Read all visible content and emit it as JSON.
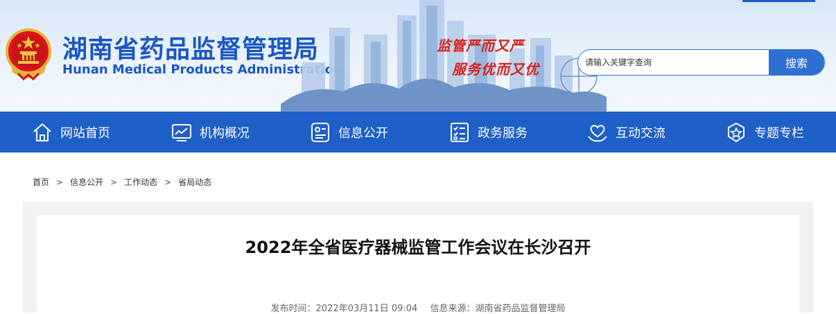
{
  "header": {
    "title": "湖南省药品监督管理局",
    "subtitle": "Hunan Medical Products Administration",
    "slogan_line1": "监管严而又严",
    "slogan_line2": "服务优而又优"
  },
  "search": {
    "placeholder": "请输入关键字查询",
    "button_label": "搜索"
  },
  "nav": {
    "items": [
      {
        "label": "网站首页",
        "icon": "home-icon"
      },
      {
        "label": "机构概况",
        "icon": "chart-monitor-icon"
      },
      {
        "label": "信息公开",
        "icon": "id-card-icon"
      },
      {
        "label": "政务服务",
        "icon": "checklist-icon"
      },
      {
        "label": "互动交流",
        "icon": "heart-hand-icon"
      },
      {
        "label": "专题专栏",
        "icon": "star-badge-icon"
      }
    ]
  },
  "breadcrumb": {
    "items": [
      "首页",
      "信息公开",
      "工作动态",
      "省局动态"
    ],
    "separator": ">"
  },
  "article": {
    "title": "2022年全省医疗器械监管工作会议在长沙召开",
    "publish_time_label": "发布时间：2022年03月11日 09:04",
    "source_label": "信息来源：湖南省药品监督管理局"
  },
  "colors": {
    "brand_blue": "#1e5fc8",
    "title_blue": "#1a56c4",
    "slogan_red": "#d9201a",
    "content_bg": "#f1f1f1"
  }
}
